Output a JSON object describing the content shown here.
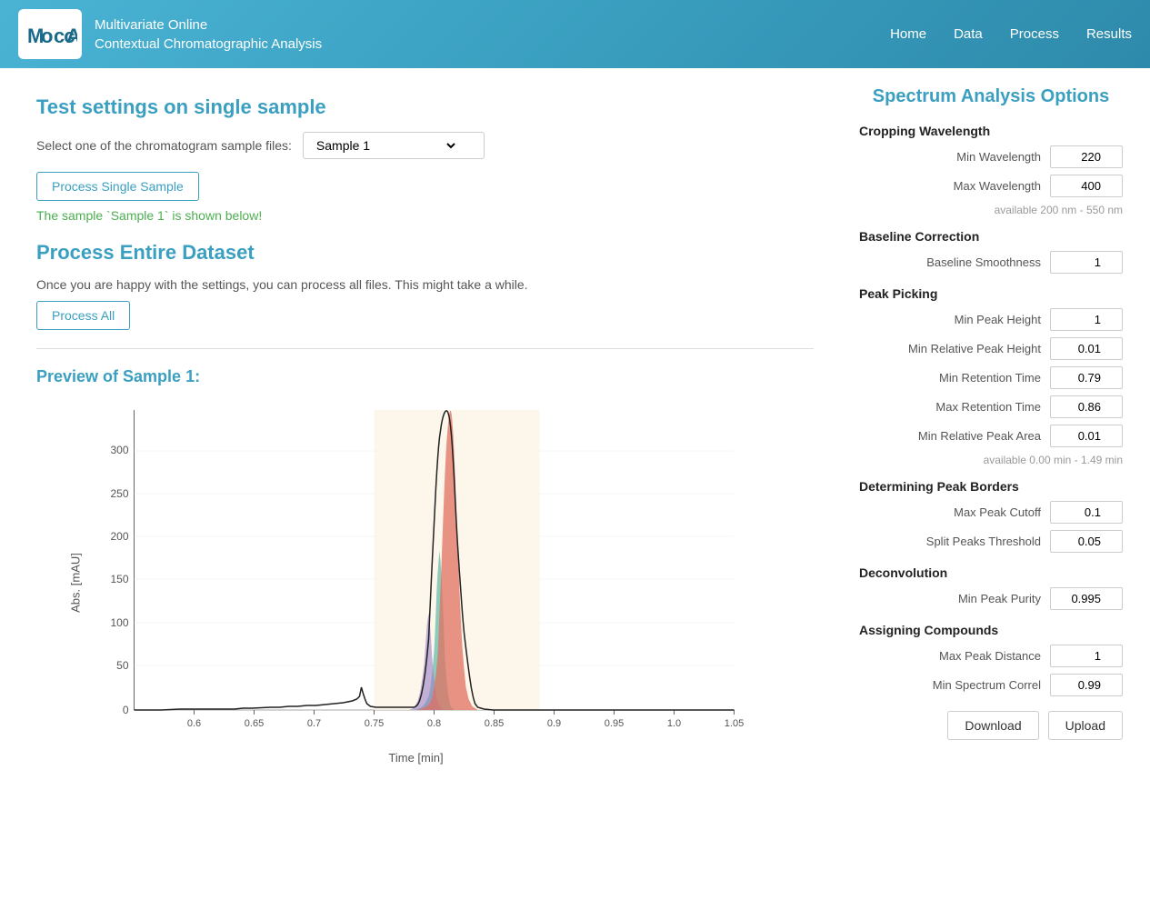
{
  "header": {
    "logo_text": "MoccA",
    "app_name_line1": "Multivariate Online",
    "app_name_line2": "Contextual Chromatographic Analysis",
    "nav": [
      "Home",
      "Data",
      "Process",
      "Results"
    ]
  },
  "left": {
    "test_section_title": "Test settings on single sample",
    "sample_select_label": "Select one of the chromatogram sample files:",
    "sample_value": "Sample 1",
    "process_single_button": "Process Single Sample",
    "success_message": "The sample `Sample 1` is shown below!",
    "entire_dataset_title": "Process Entire Dataset",
    "entire_dataset_desc": "Once you are happy with the settings, you can process all files. This might take a while.",
    "process_all_button": "Process All",
    "preview_title": "Preview of Sample 1:",
    "chart": {
      "x_label": "Time [min]",
      "y_label": "Abs. [mAU]",
      "x_ticks": [
        "0.6",
        "0.65",
        "0.7",
        "0.75",
        "0.8",
        "0.85",
        "0.9",
        "0.95",
        "1.0",
        "1.05"
      ],
      "y_ticks": [
        "0",
        "50",
        "100",
        "150",
        "200",
        "250",
        "300"
      ]
    }
  },
  "right": {
    "panel_title": "Spectrum Analysis Options",
    "cropping_wavelength": {
      "header": "Cropping Wavelength",
      "min_wavelength_label": "Min Wavelength",
      "min_wavelength_value": "220",
      "max_wavelength_label": "Max Wavelength",
      "max_wavelength_value": "400",
      "available_note": "available 200 nm - 550 nm"
    },
    "baseline_correction": {
      "header": "Baseline Correction",
      "smoothness_label": "Baseline Smoothness",
      "smoothness_value": "1"
    },
    "peak_picking": {
      "header": "Peak Picking",
      "min_peak_height_label": "Min Peak Height",
      "min_peak_height_value": "1",
      "min_rel_peak_height_label": "Min Relative Peak Height",
      "min_rel_peak_height_value": "0.01",
      "min_retention_time_label": "Min Retention Time",
      "min_retention_time_value": "0.79",
      "max_retention_time_label": "Max Retention Time",
      "max_retention_time_value": "0.86",
      "min_rel_peak_area_label": "Min Relative Peak Area",
      "min_rel_peak_area_value": "0.01",
      "available_note": "available 0.00 min - 1.49 min"
    },
    "determining_peak_borders": {
      "header": "Determining Peak Borders",
      "max_peak_cutoff_label": "Max Peak Cutoff",
      "max_peak_cutoff_value": "0.1",
      "split_peaks_threshold_label": "Split Peaks Threshold",
      "split_peaks_threshold_value": "0.05"
    },
    "deconvolution": {
      "header": "Deconvolution",
      "min_peak_purity_label": "Min Peak Purity",
      "min_peak_purity_value": "0.995"
    },
    "assigning_compounds": {
      "header": "Assigning Compounds",
      "max_peak_distance_label": "Max Peak Distance",
      "max_peak_distance_value": "1",
      "min_spectrum_correl_label": "Min Spectrum Correl",
      "min_spectrum_correl_value": "0.99"
    },
    "download_button": "Download",
    "upload_button": "Upload"
  }
}
